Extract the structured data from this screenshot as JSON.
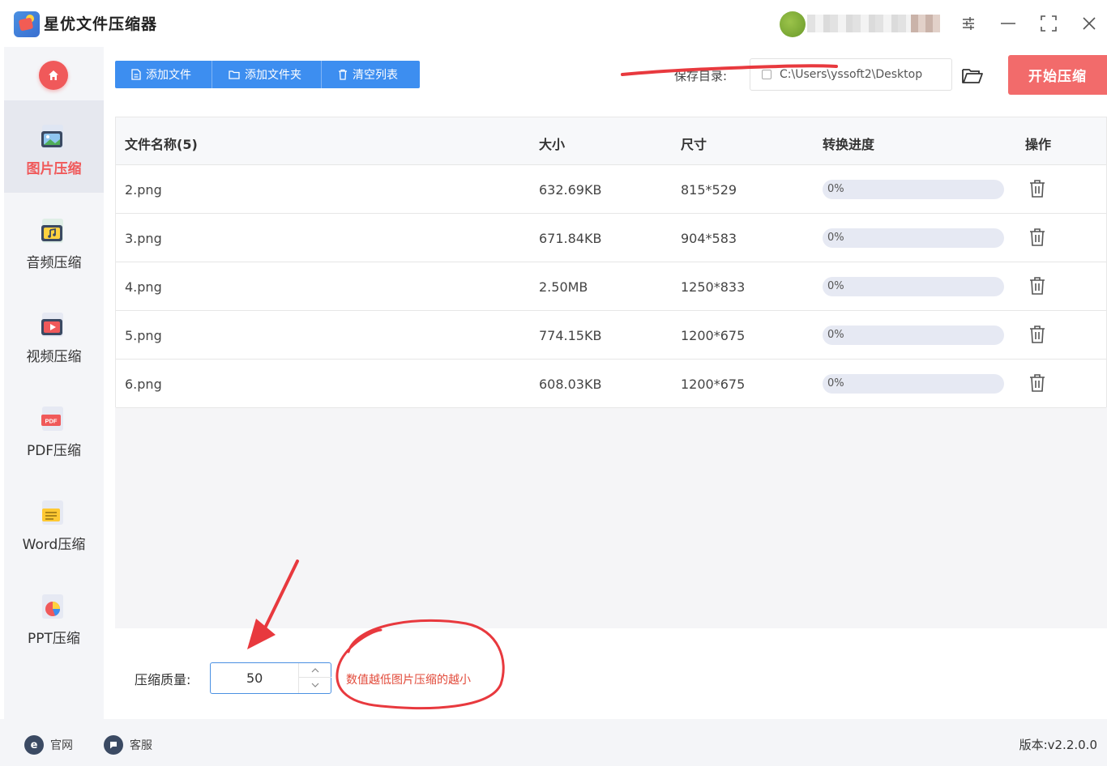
{
  "app": {
    "title": "星优文件压缩器"
  },
  "sidebar": {
    "items": [
      {
        "label": "图片压缩",
        "icon": "image-compress-icon",
        "active": true
      },
      {
        "label": "音频压缩",
        "icon": "audio-compress-icon",
        "active": false
      },
      {
        "label": "视频压缩",
        "icon": "video-compress-icon",
        "active": false
      },
      {
        "label": "PDF压缩",
        "icon": "pdf-compress-icon",
        "active": false
      },
      {
        "label": "Word压缩",
        "icon": "word-compress-icon",
        "active": false
      },
      {
        "label": "PPT压缩",
        "icon": "ppt-compress-icon",
        "active": false
      }
    ]
  },
  "toolbar": {
    "add_file": "添加文件",
    "add_folder": "添加文件夹",
    "clear_list": "清空列表",
    "save_label": "保存目录:",
    "save_path": "C:\\Users\\yssoft2\\Desktop",
    "start": "开始压缩"
  },
  "table": {
    "headers": {
      "name": "文件名称(5)",
      "size": "大小",
      "dim": "尺寸",
      "progress": "转换进度",
      "op": "操作"
    },
    "rows": [
      {
        "name": "2.png",
        "size": "632.69KB",
        "dim": "815*529",
        "progress": "0%"
      },
      {
        "name": "3.png",
        "size": "671.84KB",
        "dim": "904*583",
        "progress": "0%"
      },
      {
        "name": "4.png",
        "size": "2.50MB",
        "dim": "1250*833",
        "progress": "0%"
      },
      {
        "name": "5.png",
        "size": "774.15KB",
        "dim": "1200*675",
        "progress": "0%"
      },
      {
        "name": "6.png",
        "size": "608.03KB",
        "dim": "1200*675",
        "progress": "0%"
      }
    ]
  },
  "settings": {
    "quality_label": "压缩质量:",
    "quality_value": "50",
    "hint": "数值越低图片压缩的越小"
  },
  "status": {
    "website": "官网",
    "service": "客服",
    "version": "版本:v2.2.0.0"
  },
  "colors": {
    "accent_blue": "#3d8ef0",
    "accent_red": "#f26b6b",
    "annotation_red": "#e8393e"
  }
}
